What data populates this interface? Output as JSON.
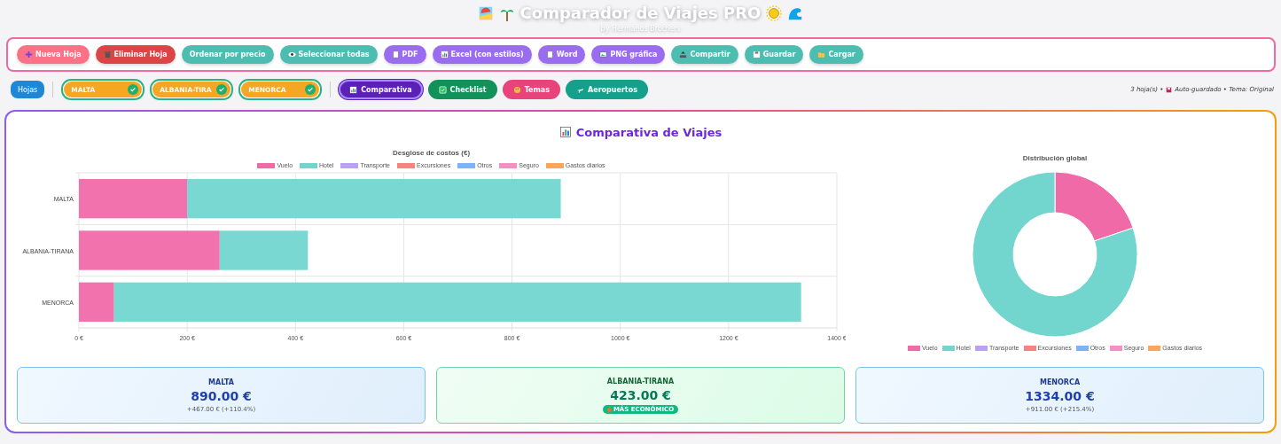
{
  "header": {
    "title": "Comparador de Viajes PRO",
    "subtitle": "by Hermanos Brothers"
  },
  "toolbar": [
    {
      "label": "Nueva Hoja",
      "color": "#fb7185"
    },
    {
      "label": "Eliminar Hoja",
      "color": "#dc4545"
    },
    {
      "label": "Ordenar por precio",
      "color": "#4dbdb2"
    },
    {
      "label": "Seleccionar todas",
      "color": "#4dbdb2"
    },
    {
      "label": "PDF",
      "color": "#9a6cf0"
    },
    {
      "label": "Excel (con estilos)",
      "color": "#9a6cf0"
    },
    {
      "label": "Word",
      "color": "#9a6cf0"
    },
    {
      "label": "PNG gráfica",
      "color": "#9a6cf0"
    },
    {
      "label": "Compartir",
      "color": "#4dbdb2"
    },
    {
      "label": "Guardar",
      "color": "#4dbdb2"
    },
    {
      "label": "Cargar",
      "color": "#4dbdb2"
    }
  ],
  "sheets_button": "Hojas",
  "sheets": [
    {
      "name": "MALTA",
      "checked": true
    },
    {
      "name": "ALBANIA-TIRA",
      "checked": true
    },
    {
      "name": "MENORCA",
      "checked": true
    }
  ],
  "views": [
    {
      "label": "Comparativa",
      "selected": true,
      "color": "#5b21b6"
    },
    {
      "label": "Checklist",
      "selected": false,
      "color": "#12915a"
    },
    {
      "label": "Temas",
      "selected": false,
      "color": "#e8437a"
    },
    {
      "label": "Aeropuertos",
      "selected": false,
      "color": "#14a08a"
    }
  ],
  "status": {
    "count": "3 hoja(s) •",
    "rest": "Auto-guardado • Tema: Original"
  },
  "panel_title": "Comparativa de Viajes",
  "bar_chart": {
    "chart_data": {
      "type": "bar",
      "orientation": "horizontal",
      "stacked": true,
      "legend": "top",
      "grid": true,
      "title": "Desglose de costos (€)",
      "categories": [
        "MALTA",
        "ALBANIA-TIRANA",
        "MENORCA"
      ],
      "series": [
        {
          "name": "Vuelo",
          "color": "#f06aa8",
          "values": [
            200,
            260,
            65
          ]
        },
        {
          "name": "Hotel",
          "color": "#72d6cf",
          "values": [
            690,
            163,
            1269
          ]
        },
        {
          "name": "Transporte",
          "color": "#b9a2f5",
          "values": [
            0,
            0,
            0
          ]
        },
        {
          "name": "Excursiones",
          "color": "#f7827f",
          "values": [
            0,
            0,
            0
          ]
        },
        {
          "name": "Otros",
          "color": "#7db3f5",
          "values": [
            0,
            0,
            0
          ]
        },
        {
          "name": "Seguro",
          "color": "#f58fc4",
          "values": [
            0,
            0,
            0
          ]
        },
        {
          "name": "Gastos diarios",
          "color": "#f9a65a",
          "values": [
            0,
            0,
            0
          ]
        }
      ],
      "xlim": [
        0,
        1400
      ],
      "xticks": [
        {
          "value": 0,
          "label": "0 €"
        },
        {
          "value": 200,
          "label": "200 €"
        },
        {
          "value": 400,
          "label": "400 €"
        },
        {
          "value": 600,
          "label": "600 €"
        },
        {
          "value": 800,
          "label": "800 €"
        },
        {
          "value": 1000,
          "label": "1000 €"
        },
        {
          "value": 1200,
          "label": "1200 €"
        },
        {
          "value": 1400,
          "label": "1400 €"
        }
      ]
    }
  },
  "donut_chart": {
    "chart_data": {
      "type": "donut",
      "legend": "bottom",
      "title": "Distribución global",
      "categories": [
        "Vuelo",
        "Hotel",
        "Transporte",
        "Excursiones",
        "Otros",
        "Seguro",
        "Gastos diarios"
      ],
      "colors": [
        "#f06aa8",
        "#72d6cf",
        "#b9a2f5",
        "#f7827f",
        "#7db3f5",
        "#f58fc4",
        "#f9a65a"
      ],
      "values": [
        19.8,
        80.2,
        0,
        0,
        0,
        0,
        0
      ]
    }
  },
  "cards": [
    {
      "kind": "normal",
      "name": "MALTA",
      "total": "890.00 €",
      "note": "+467.00 € (+110.4%)"
    },
    {
      "kind": "cheapest",
      "name": "ALBANIA-TIRANA",
      "total": "423.00 €",
      "note": "MÁS ECONÓMICO"
    },
    {
      "kind": "normal",
      "name": "MENORCA",
      "total": "1334.00 €",
      "note": "+911.00 € (+215.4%)"
    }
  ]
}
